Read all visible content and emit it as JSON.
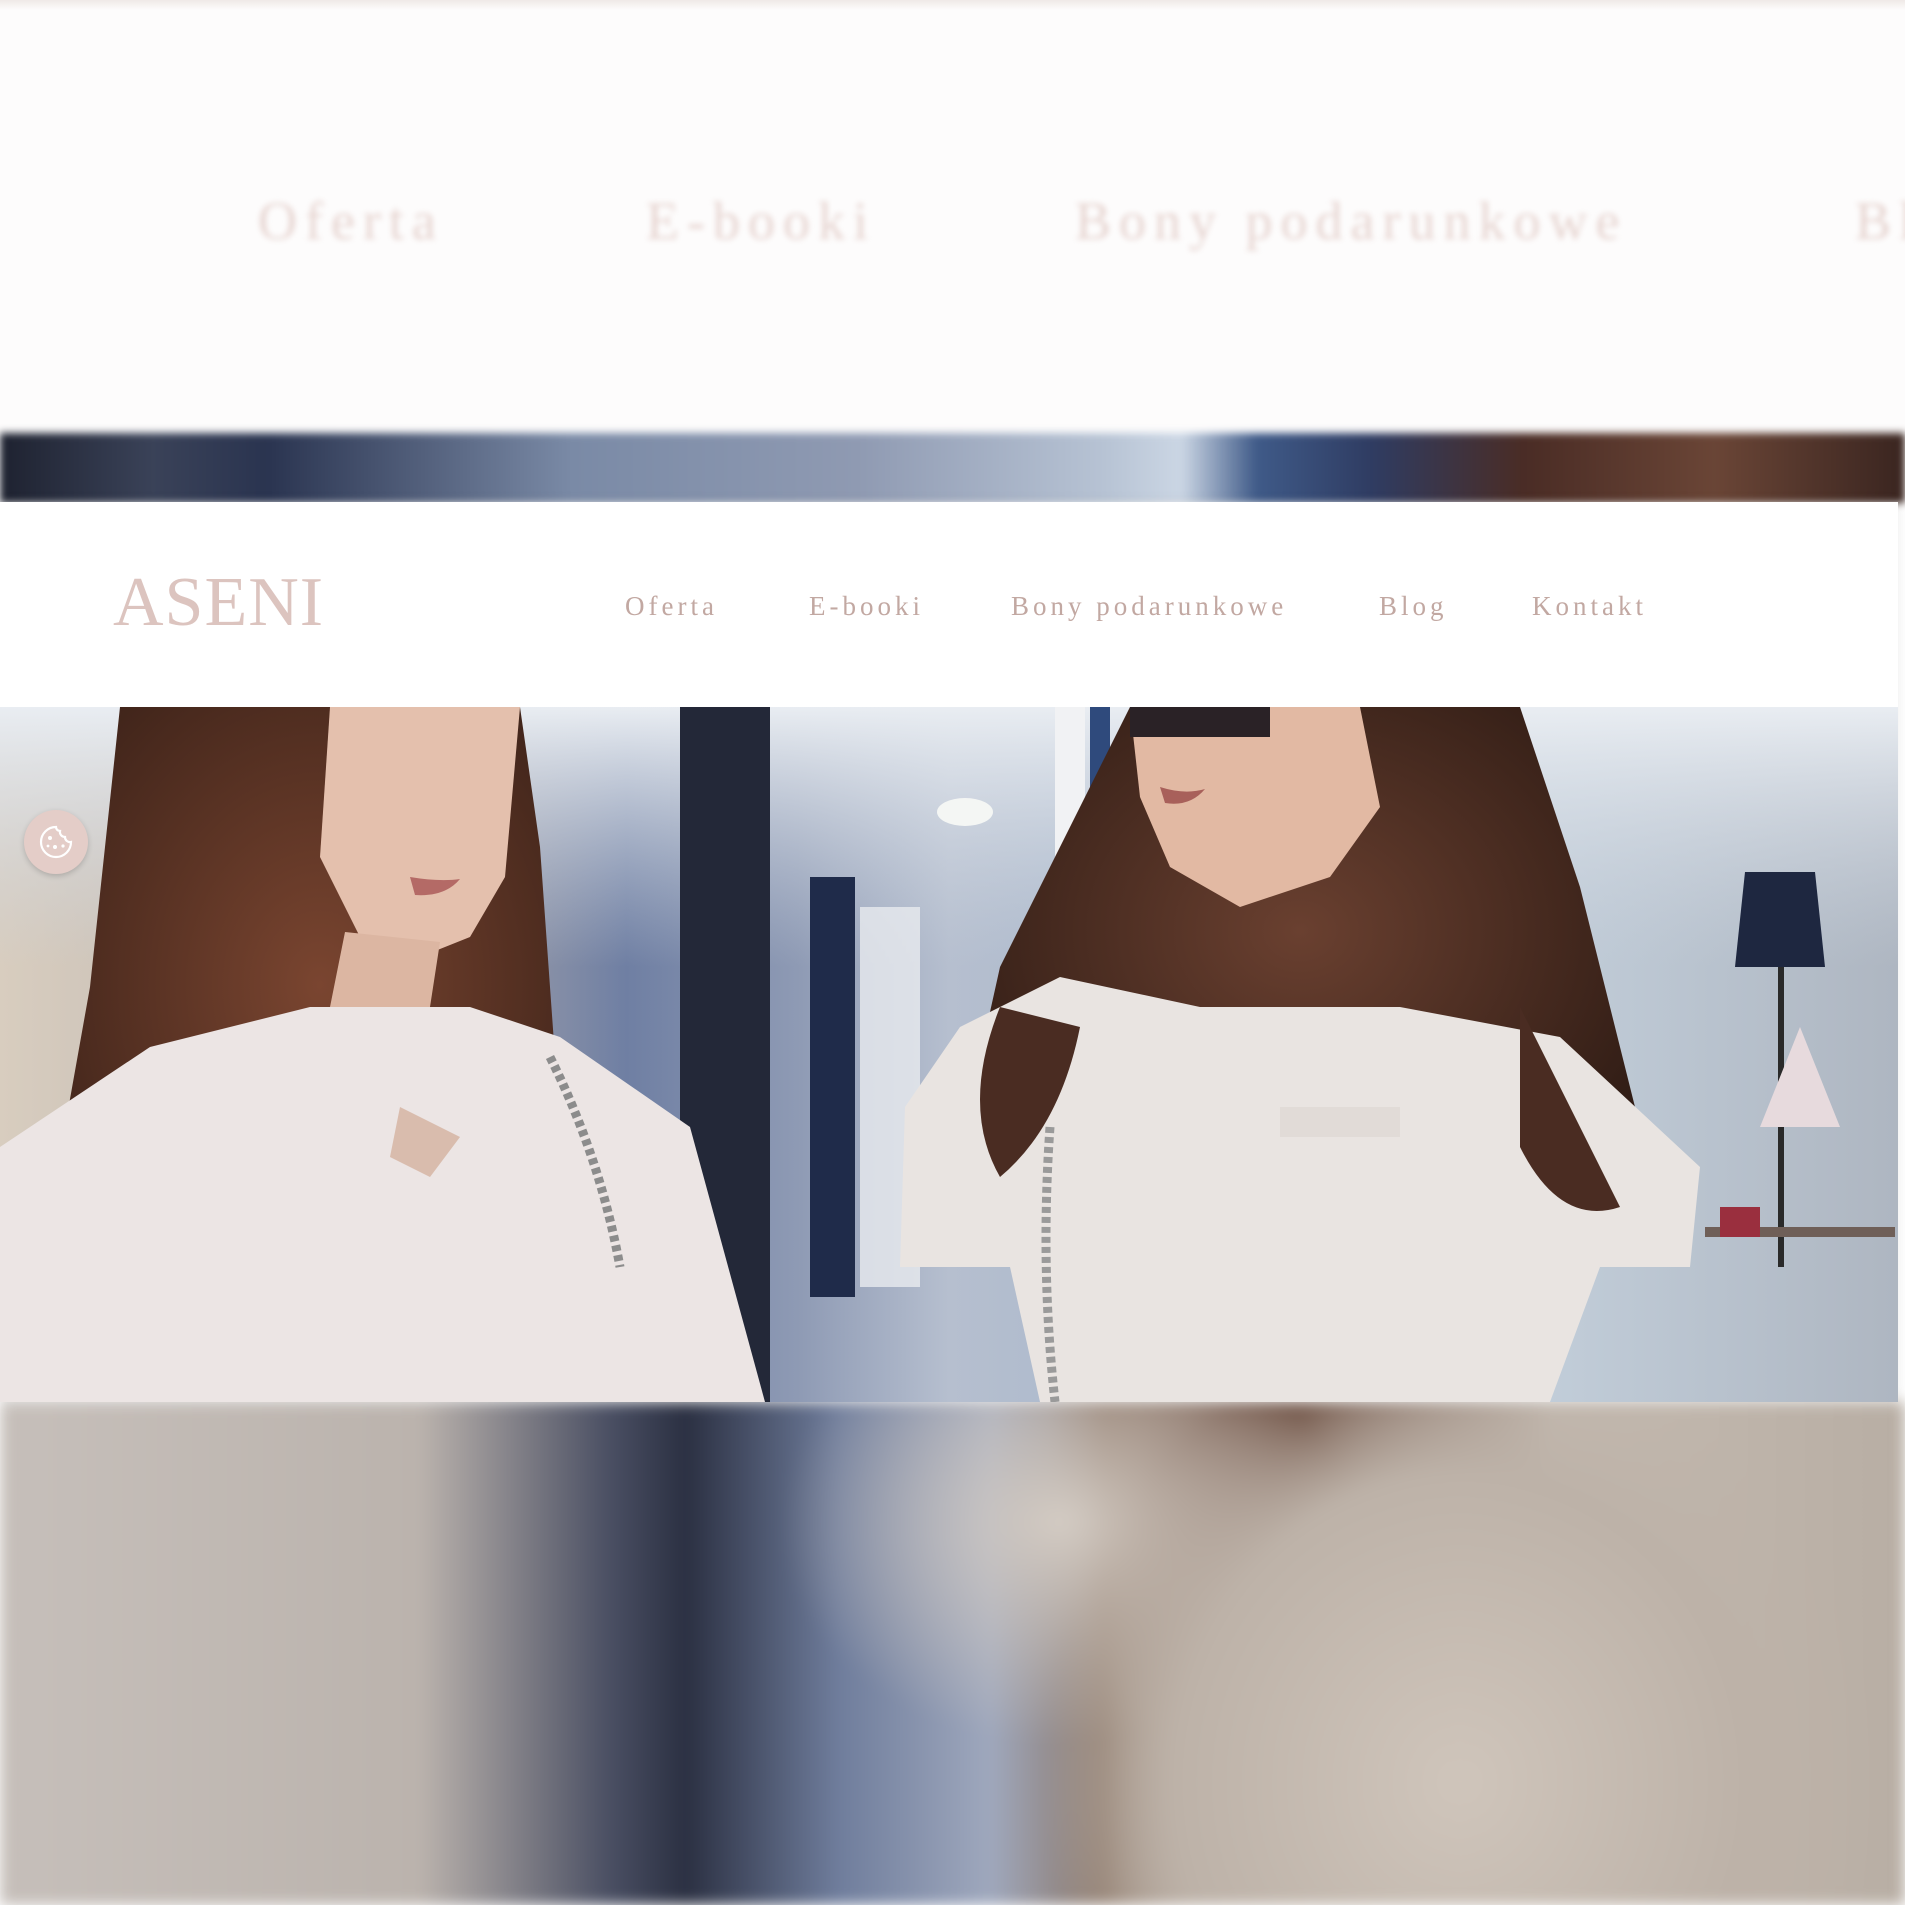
{
  "brand": {
    "name": "ASENI"
  },
  "nav": {
    "items": [
      {
        "label": "Oferta"
      },
      {
        "label": "E-booki"
      },
      {
        "label": "Bony podarunkowe"
      },
      {
        "label": "Blog"
      },
      {
        "label": "Kontakt"
      }
    ]
  },
  "background_nav": {
    "items": [
      {
        "label": "Oferta"
      },
      {
        "label": "E-booki"
      },
      {
        "label": "Bony podarunkowe"
      },
      {
        "label": "Bl"
      }
    ]
  },
  "hero": {
    "image": "two-women-walking-in-shopping-mall"
  },
  "cookie_settings": {
    "icon": "cookie-icon"
  },
  "colors": {
    "brand": "#dcc4bf",
    "nav_text": "#c2a8a2",
    "cookie_button": "#e4cdc8",
    "background": "#ffffff"
  }
}
